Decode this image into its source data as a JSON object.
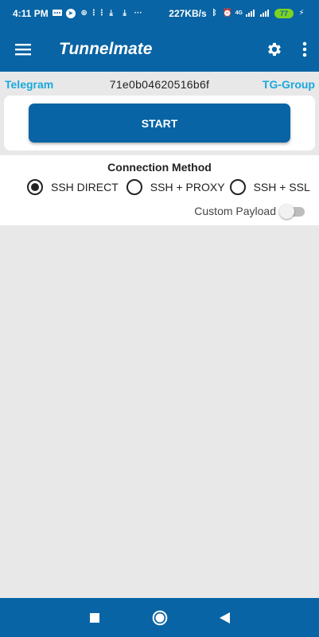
{
  "status_bar": {
    "time": "4:11 PM",
    "speed": "227KB/s",
    "network": "4G",
    "battery": "77",
    "icons": [
      "message-icon",
      "browser-icon",
      "plus-icon",
      "app-icon",
      "download-icon",
      "download-icon",
      "more-dots-icon",
      "bluetooth-icon",
      "alarm-icon",
      "signal-icon",
      "signal-icon",
      "battery-icon",
      "charging-icon"
    ]
  },
  "app_bar": {
    "title": "Tunnelmate",
    "menu_icon": "hamburger-menu-icon",
    "settings_icon": "gear-icon",
    "more_icon": "more-vertical-icon"
  },
  "info": {
    "left_link": "Telegram",
    "code": "71e0b04620516b6f",
    "right_link": "TG-Group"
  },
  "start_button": {
    "label": "START"
  },
  "connection": {
    "title": "Connection Method",
    "options": [
      {
        "label": "SSH DIRECT",
        "selected": true
      },
      {
        "label": "SSH + PROXY",
        "selected": false
      },
      {
        "label": "SSH + SSL",
        "selected": false
      }
    ],
    "custom_payload": {
      "label": "Custom Payload",
      "enabled": false
    }
  },
  "nav_bar": {
    "icons": [
      "recents-square-icon",
      "home-circle-icon",
      "back-triangle-icon"
    ]
  },
  "colors": {
    "primary": "#0864a4",
    "link": "#1aa8dc",
    "background": "#e8e8e8",
    "battery": "#7ed321"
  }
}
